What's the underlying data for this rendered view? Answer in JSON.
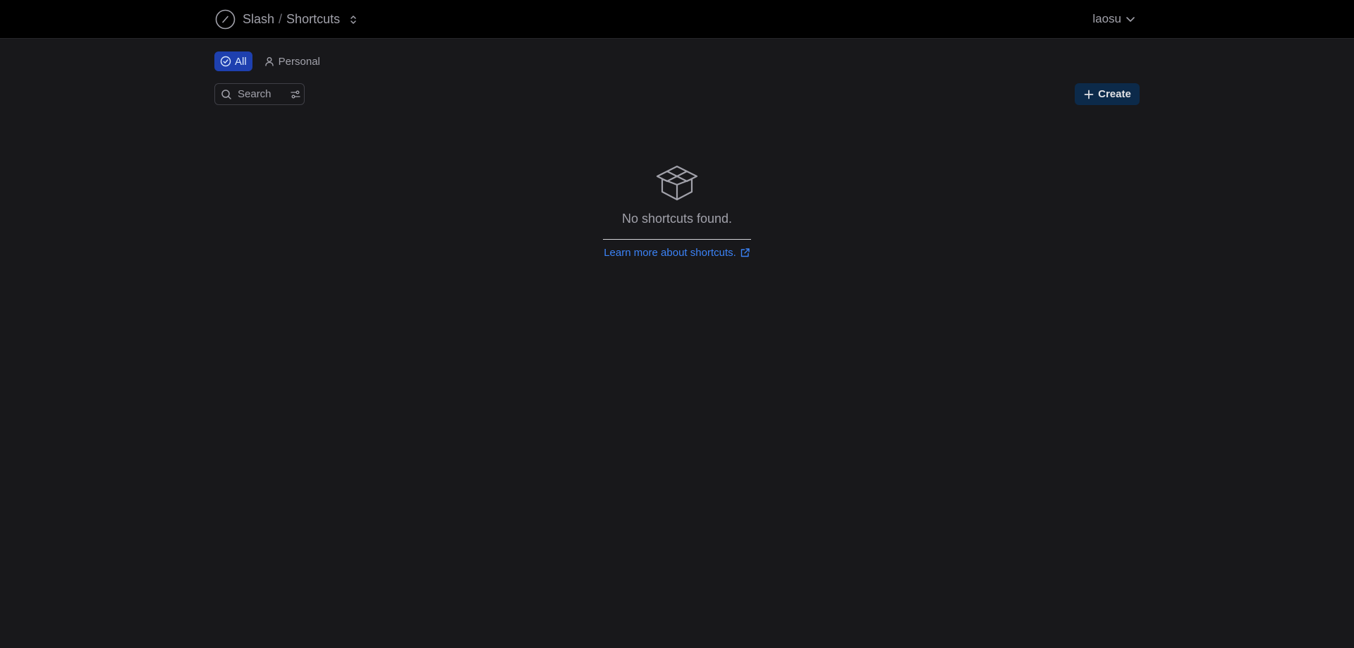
{
  "header": {
    "brand_name": "Slash",
    "separator": "/",
    "page_name": "Shortcuts",
    "user_name": "laosu",
    "icons": {
      "logo": "slash-circle-icon",
      "switcher": "chevrons-up-down-icon",
      "user_menu": "chevron-down-icon"
    }
  },
  "tabs": [
    {
      "label": "All",
      "icon": "circle-check-icon",
      "active": true
    },
    {
      "label": "Personal",
      "icon": "user-icon",
      "active": false
    }
  ],
  "search": {
    "placeholder": "Search",
    "value": ""
  },
  "toolbar": {
    "create_label": "Create"
  },
  "empty_state": {
    "icon": "package-box-icon",
    "message": "No shortcuts found.",
    "link_text": "Learn more about shortcuts."
  },
  "colors": {
    "background": "#18181b",
    "topbar": "#000000",
    "active_tab": "#1e40af",
    "create_button": "#0c2a4a",
    "link": "#3b82f6"
  }
}
